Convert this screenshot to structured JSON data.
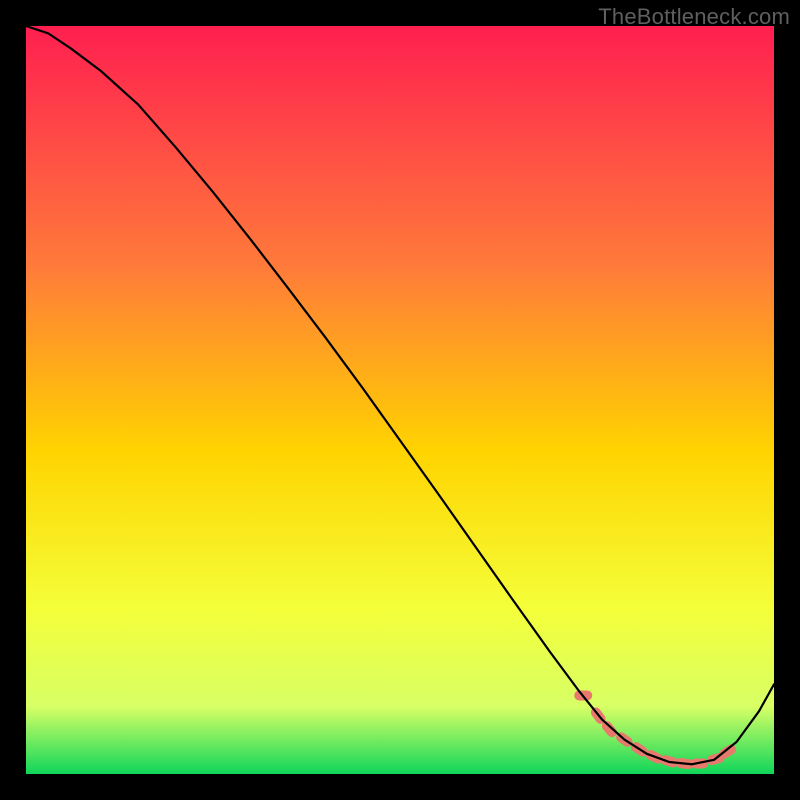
{
  "watermark": "TheBottleneck.com",
  "colors": {
    "gradient_top": "#ff1f50",
    "gradient_mid_upper": "#ff7a3a",
    "gradient_mid": "#ffd400",
    "gradient_mid_lower": "#f4ff3a",
    "gradient_lower": "#d7ff65",
    "gradient_bottom": "#0fd65a",
    "curve": "#000000",
    "marker": "#e77a6d",
    "frame": "#000000"
  },
  "chart_data": {
    "type": "line",
    "title": "",
    "xlabel": "",
    "ylabel": "",
    "xlim": [
      0,
      100
    ],
    "ylim": [
      0,
      100
    ],
    "series": [
      {
        "name": "bottleneck-curve",
        "x": [
          0,
          3,
          6,
          10,
          15,
          20,
          25,
          30,
          35,
          40,
          45,
          50,
          55,
          60,
          65,
          70,
          74,
          77,
          80,
          83,
          86,
          89,
          92,
          95,
          98,
          100
        ],
        "y": [
          100,
          99,
          97,
          94,
          89.5,
          83.8,
          77.8,
          71.5,
          65,
          58.4,
          51.6,
          44.6,
          37.6,
          30.5,
          23.4,
          16.4,
          11,
          7.3,
          4.6,
          2.7,
          1.6,
          1.3,
          1.9,
          4.3,
          8.4,
          12
        ]
      }
    ],
    "markers": {
      "name": "highlighted-points",
      "color": "#e77a6d",
      "x": [
        74.5,
        76.5,
        78.0,
        80.0,
        82.0,
        84.0,
        86.0,
        88.0,
        90.0,
        92.2,
        93.8
      ],
      "y": [
        10.5,
        7.8,
        6.0,
        4.6,
        3.3,
        2.3,
        1.7,
        1.4,
        1.4,
        2.0,
        3.0
      ]
    },
    "notes": "x is a normalized horizontal axis (0–100 left→right); y is a normalized vertical axis (0–100 bottom→top). Curve descends from top-left, bottoms out near x≈88, then rises toward the right edge. Background is a vertical red→yellow→green gradient."
  }
}
